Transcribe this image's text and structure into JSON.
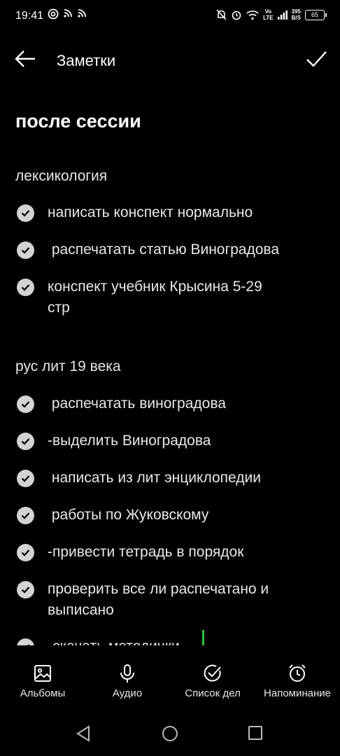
{
  "status_bar": {
    "time": "19:41",
    "net_speed_value": "395",
    "net_speed_unit": "B/S",
    "battery": "65",
    "volte_line1": "Vo",
    "volte_line2": "LTE"
  },
  "app_bar": {
    "title": "Заметки"
  },
  "note": {
    "title": "после сессии",
    "sections": [
      {
        "heading": "лексикология",
        "items": [
          "написать конспект нормально",
          " распечатать статью Виноградова",
          "конспект учебник Крысина 5-29\nстр"
        ]
      },
      {
        "heading": "рус лит 19 века",
        "items": [
          " распечатать виноградова",
          "-выделить Виноградова",
          " написать из лит энциклопедии",
          " работы по Жуковскому",
          "-привести тетрадь в порядок",
          "проверить все ли распечатано и\nвыписано",
          "-скачать методички"
        ]
      }
    ]
  },
  "toolbar": {
    "albums": "Альбомы",
    "audio": "Аудио",
    "checklist": "Список дел",
    "reminder": "Напоминание"
  },
  "colors": {
    "background": "#000000",
    "check": "#d3d3d3",
    "cursor": "#2fbf3a"
  }
}
